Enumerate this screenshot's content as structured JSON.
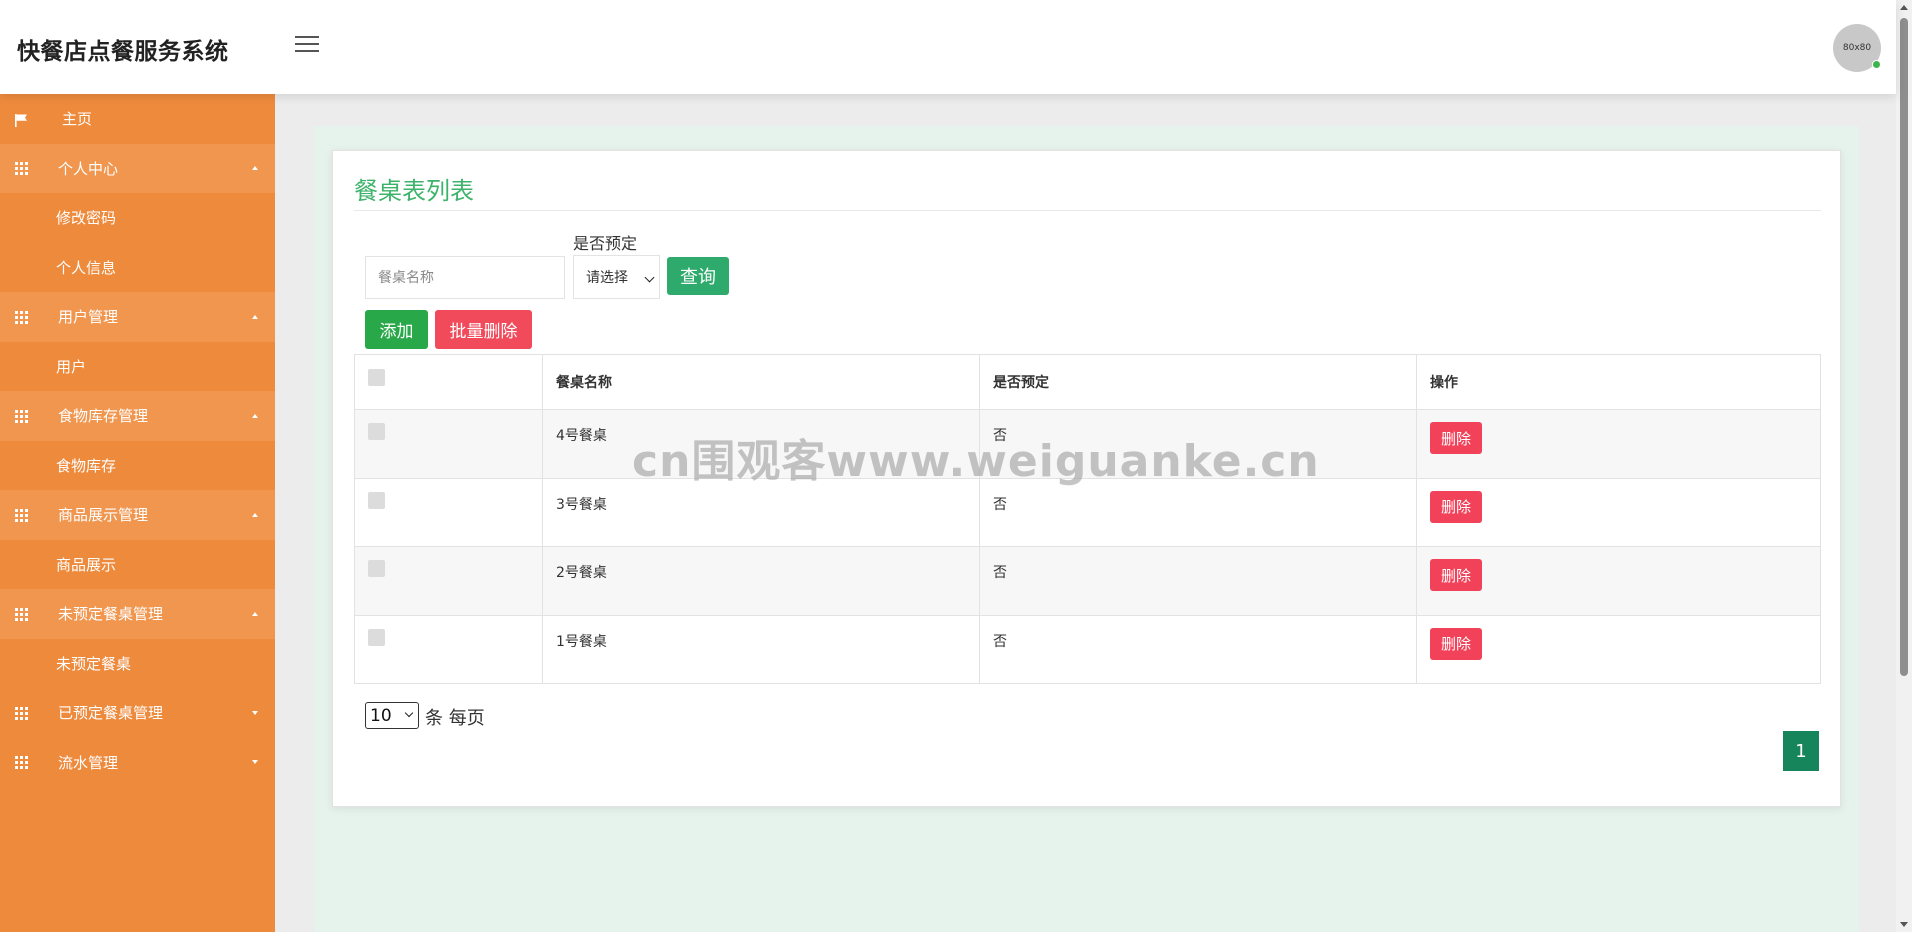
{
  "app": {
    "title": "快餐店点餐服务系统",
    "avatar_text": "80x80"
  },
  "sidebar": {
    "items": [
      {
        "label": "主页",
        "kind": "home",
        "icon": "flag-icon"
      },
      {
        "label": "个人中心",
        "kind": "parent",
        "open": true,
        "icon": "grid-icon"
      },
      {
        "label": "修改密码",
        "kind": "child"
      },
      {
        "label": "个人信息",
        "kind": "child"
      },
      {
        "label": "用户管理",
        "kind": "parent",
        "open": true,
        "icon": "grid-icon"
      },
      {
        "label": "用户",
        "kind": "child"
      },
      {
        "label": "食物库存管理",
        "kind": "parent",
        "open": true,
        "icon": "grid-icon"
      },
      {
        "label": "食物库存",
        "kind": "child"
      },
      {
        "label": "商品展示管理",
        "kind": "parent",
        "open": true,
        "icon": "grid-icon"
      },
      {
        "label": "商品展示",
        "kind": "child"
      },
      {
        "label": "未预定餐桌管理",
        "kind": "parent",
        "open": true,
        "icon": "grid-icon"
      },
      {
        "label": "未预定餐桌",
        "kind": "child"
      },
      {
        "label": "已预定餐桌管理",
        "kind": "parent",
        "open": false,
        "icon": "grid-icon"
      },
      {
        "label": "流水管理",
        "kind": "parent",
        "open": false,
        "icon": "grid-icon"
      }
    ]
  },
  "page": {
    "title": "餐桌表列表",
    "search": {
      "name_placeholder": "餐桌名称",
      "reserve_label": "是否预定",
      "reserve_value": "请选择",
      "query_label": "查询"
    },
    "actions": {
      "add_label": "添加",
      "batch_delete_label": "批量删除"
    },
    "table": {
      "columns": [
        "餐桌名称",
        "是否预定",
        "操作"
      ],
      "rows": [
        {
          "name": "4号餐桌",
          "reserved": "否",
          "action": "删除"
        },
        {
          "name": "3号餐桌",
          "reserved": "否",
          "action": "删除"
        },
        {
          "name": "2号餐桌",
          "reserved": "否",
          "action": "删除"
        },
        {
          "name": "1号餐桌",
          "reserved": "否",
          "action": "删除"
        }
      ]
    },
    "pagination": {
      "page_size": "10",
      "per_page_label": "条 每页",
      "current_page": "1"
    }
  },
  "watermark": "cn围观客www.weiguanke.cn",
  "colors": {
    "sidebar": "#ee8a3c",
    "accent_green": "#3cb36a",
    "danger": "#f2425a"
  }
}
